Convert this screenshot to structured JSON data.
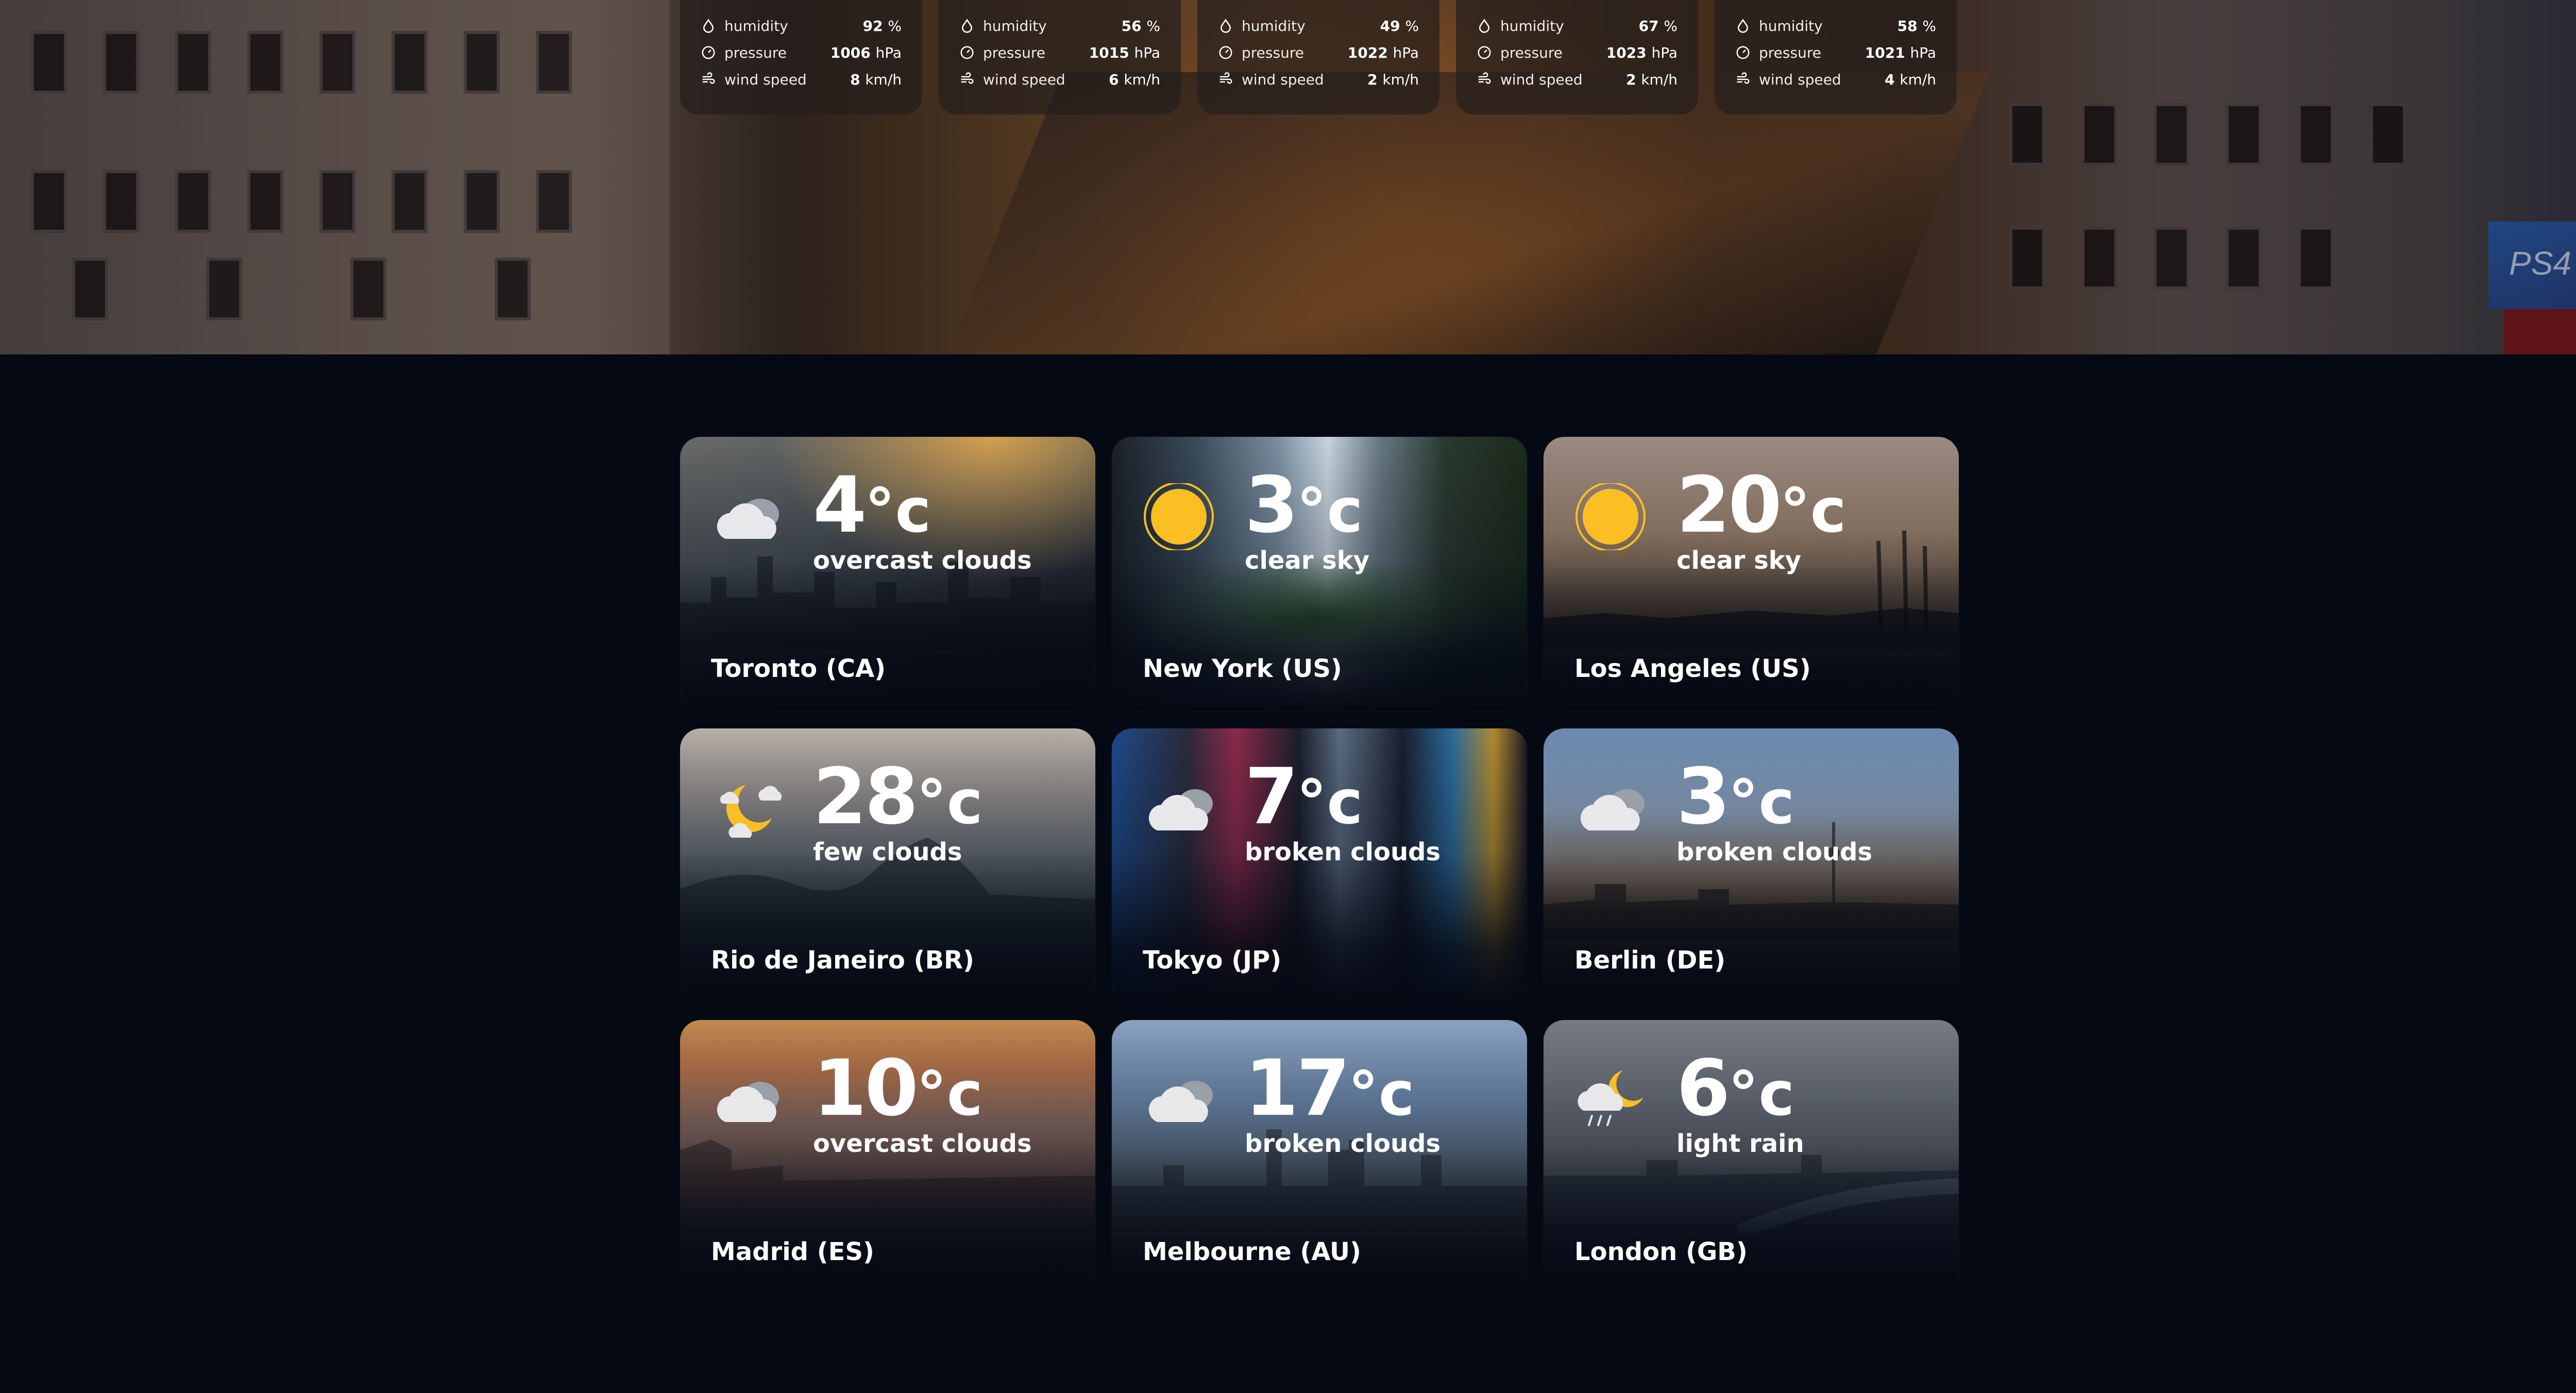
{
  "hero": {
    "sign_text": "PS4",
    "stats": [
      {
        "humidity_label": "humidity",
        "humidity": "92",
        "humidity_unit": "%",
        "pressure_label": "pressure",
        "pressure": "1006",
        "pressure_unit": "hPa",
        "wind_label": "wind speed",
        "wind": "8",
        "wind_unit": "km/h"
      },
      {
        "humidity_label": "humidity",
        "humidity": "56",
        "humidity_unit": "%",
        "pressure_label": "pressure",
        "pressure": "1015",
        "pressure_unit": "hPa",
        "wind_label": "wind speed",
        "wind": "6",
        "wind_unit": "km/h"
      },
      {
        "humidity_label": "humidity",
        "humidity": "49",
        "humidity_unit": "%",
        "pressure_label": "pressure",
        "pressure": "1022",
        "pressure_unit": "hPa",
        "wind_label": "wind speed",
        "wind": "2",
        "wind_unit": "km/h"
      },
      {
        "humidity_label": "humidity",
        "humidity": "67",
        "humidity_unit": "%",
        "pressure_label": "pressure",
        "pressure": "1023",
        "pressure_unit": "hPa",
        "wind_label": "wind speed",
        "wind": "2",
        "wind_unit": "km/h"
      },
      {
        "humidity_label": "humidity",
        "humidity": "58",
        "humidity_unit": "%",
        "pressure_label": "pressure",
        "pressure": "1021",
        "pressure_unit": "hPa",
        "wind_label": "wind speed",
        "wind": "4",
        "wind_unit": "km/h"
      }
    ]
  },
  "temp_unit": "°c",
  "cities": [
    {
      "city": "Toronto (CA)",
      "temp": "4",
      "desc": "overcast clouds",
      "icon": "overcast-clouds-icon"
    },
    {
      "city": "New York (US)",
      "temp": "3",
      "desc": "clear sky",
      "icon": "sun-icon"
    },
    {
      "city": "Los Angeles (US)",
      "temp": "20",
      "desc": "clear sky",
      "icon": "sun-icon"
    },
    {
      "city": "Rio de Janeiro (BR)",
      "temp": "28",
      "desc": "few clouds",
      "icon": "moon-clouds-icon"
    },
    {
      "city": "Tokyo (JP)",
      "temp": "7",
      "desc": "broken clouds",
      "icon": "broken-clouds-icon"
    },
    {
      "city": "Berlin (DE)",
      "temp": "3",
      "desc": "broken clouds",
      "icon": "broken-clouds-icon"
    },
    {
      "city": "Madrid (ES)",
      "temp": "10",
      "desc": "overcast clouds",
      "icon": "overcast-clouds-icon"
    },
    {
      "city": "Melbourne (AU)",
      "temp": "17",
      "desc": "broken clouds",
      "icon": "broken-clouds-icon"
    },
    {
      "city": "London (GB)",
      "temp": "6",
      "desc": "light rain",
      "icon": "moon-rain-icon"
    }
  ],
  "colors": {
    "page_bg": "#040914",
    "sun": "#fbbf24",
    "cloud": "#e8e8ea"
  }
}
